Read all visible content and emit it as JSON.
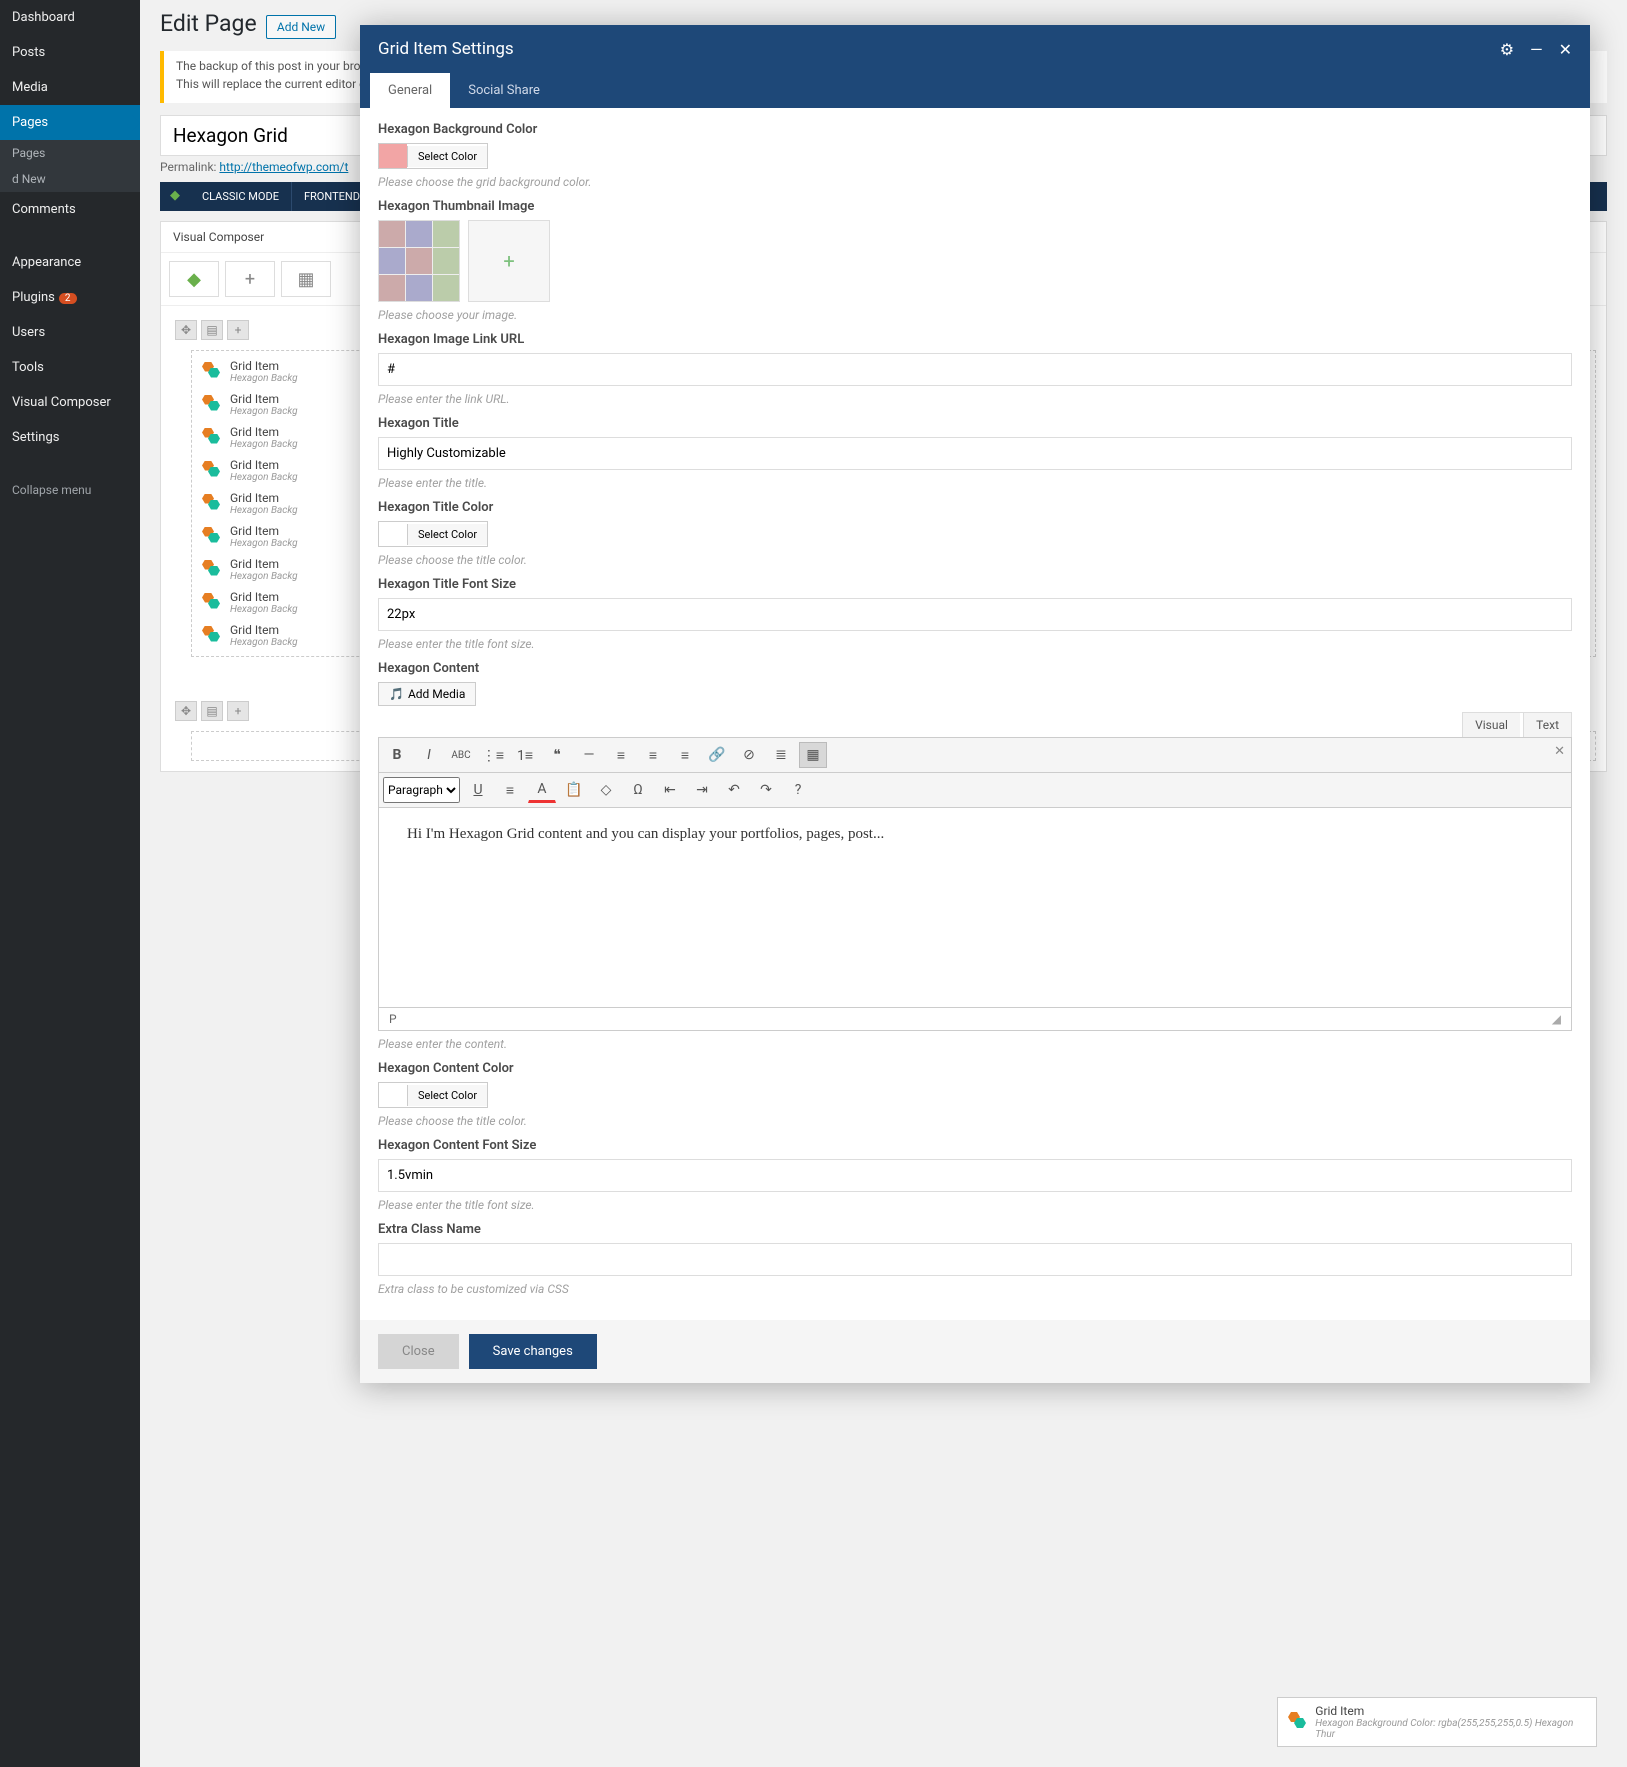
{
  "sidebar": {
    "items": [
      {
        "label": "Dashboard"
      },
      {
        "label": "Posts"
      },
      {
        "label": "Media"
      },
      {
        "label": "Pages",
        "current": true
      },
      {
        "label": "Comments"
      },
      {
        "label": "Appearance"
      },
      {
        "label": "Plugins",
        "badge": "2"
      },
      {
        "label": "Users"
      },
      {
        "label": "Tools"
      },
      {
        "label": "Visual Composer"
      },
      {
        "label": "Settings"
      }
    ],
    "sub_pages": [
      "Pages",
      "d New"
    ],
    "collapse": "Collapse menu"
  },
  "page": {
    "heading": "Edit Page",
    "add_new": "Add New",
    "notice_line1": "The backup of this post in your bro",
    "notice_line2": "This  will replace the current editor c",
    "title_value": "Hexagon Grid",
    "permalink_label": "Permalink:",
    "permalink_url": "http://themeofwp.com/t",
    "vc_modes": [
      "CLASSIC MODE",
      "FRONTEND ED"
    ],
    "composer_title": "Visual Composer",
    "grid_items": [
      {
        "title": "Grid Item",
        "sub": "Hexagon Backg"
      },
      {
        "title": "Grid Item",
        "sub": "Hexagon Backg"
      },
      {
        "title": "Grid Item",
        "sub": "Hexagon Backg"
      },
      {
        "title": "Grid Item",
        "sub": "Hexagon Backg"
      },
      {
        "title": "Grid Item",
        "sub": "Hexagon Backg"
      },
      {
        "title": "Grid Item",
        "sub": "Hexagon Backg"
      },
      {
        "title": "Grid Item",
        "sub": "Hexagon Backg"
      },
      {
        "title": "Grid Item",
        "sub": "Hexagon Backg"
      },
      {
        "title": "Grid Item",
        "sub": "Hexagon Backg"
      }
    ]
  },
  "modal": {
    "title": "Grid Item Settings",
    "tabs": [
      "General",
      "Social Share"
    ],
    "bg_color": {
      "label": "Hexagon Background Color",
      "swatch": "#f2a5a5",
      "button": "Select Color",
      "hint": "Please choose the grid background color."
    },
    "thumb": {
      "label": "Hexagon Thumbnail Image",
      "hint": "Please choose your image."
    },
    "link": {
      "label": "Hexagon Image Link URL",
      "value": "#",
      "hint": "Please enter the link URL."
    },
    "htitle": {
      "label": "Hexagon Title",
      "value": "Highly Customizable",
      "hint": "Please enter the title."
    },
    "tcolor": {
      "label": "Hexagon Title Color",
      "swatch": "#ffffff",
      "button": "Select Color",
      "hint": "Please choose the title color."
    },
    "tfont": {
      "label": "Hexagon Title Font Size",
      "value": "22px",
      "hint": "Please enter the title font size."
    },
    "content_label": "Hexagon Content",
    "add_media": "Add Media",
    "editor_tabs": [
      "Visual",
      "Text"
    ],
    "paragraph": "Paragraph",
    "editor_content": "Hi I'm Hexagon Grid content and you can display your portfolios, pages, post...",
    "editor_path": "P",
    "content_hint": "Please enter the content.",
    "ccolor": {
      "label": "Hexagon Content Color",
      "swatch": "#ffffff",
      "button": "Select Color",
      "hint": "Please choose the title color."
    },
    "cfont": {
      "label": "Hexagon Content Font Size",
      "value": "1.5vmin",
      "hint": "Please enter the title font size."
    },
    "extra": {
      "label": "Extra Class Name",
      "value": "",
      "hint": "Extra class to be customized via CSS"
    },
    "close": "Close",
    "save": "Save changes"
  },
  "float_card": {
    "title": "Grid Item",
    "sub": "Hexagon Background Color: rgba(255,255,255,0.5)  Hexagon Thur"
  }
}
